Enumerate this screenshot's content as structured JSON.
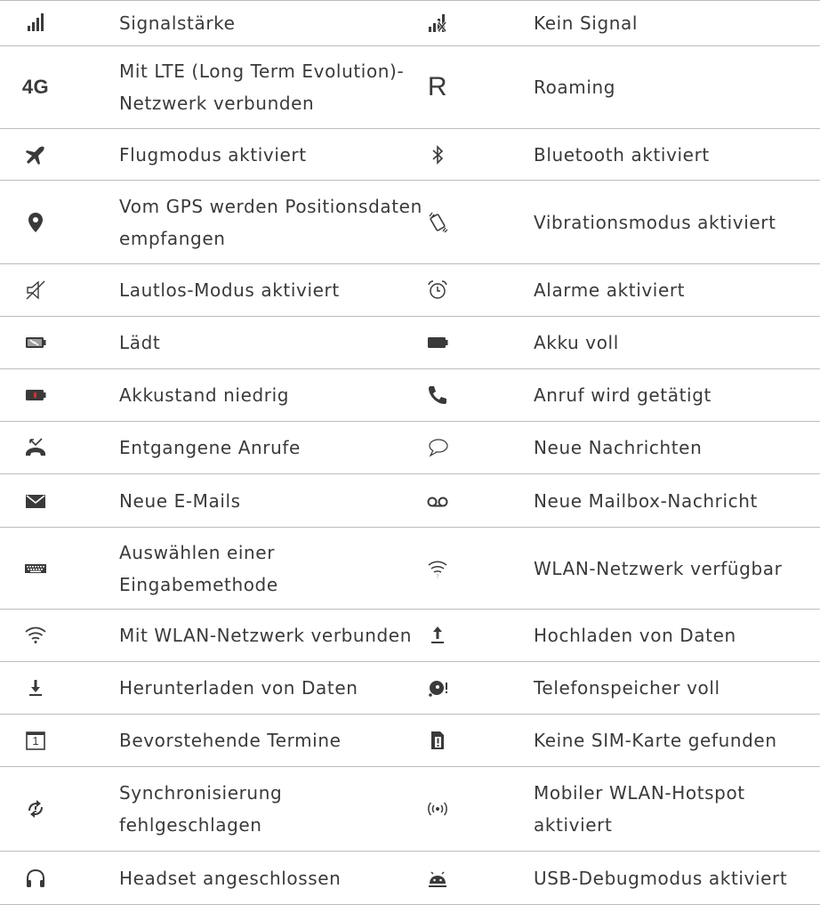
{
  "colors": {
    "icon": "#3a3a3a",
    "divider": "#bdbdbd",
    "battery_low": "#d32f2f"
  },
  "rows": [
    {
      "left": {
        "icon": "signal-strength-icon",
        "label": "Signalstärke"
      },
      "right": {
        "icon": "no-signal-icon",
        "label": "Kein Signal"
      }
    },
    {
      "left": {
        "icon": "lte-4g-icon",
        "icon_text": "4G",
        "label": "Mit LTE (Long Term Evolution)-Netzwerk verbunden"
      },
      "right": {
        "icon": "roaming-icon",
        "icon_text": "R",
        "label": "Roaming"
      }
    },
    {
      "left": {
        "icon": "airplane-icon",
        "label": "Flugmodus aktiviert"
      },
      "right": {
        "icon": "bluetooth-icon",
        "label": "Bluetooth aktiviert"
      }
    },
    {
      "left": {
        "icon": "gps-pin-icon",
        "label": "Vom GPS werden Positionsdaten empfangen"
      },
      "right": {
        "icon": "vibrate-icon",
        "label": "Vibrationsmodus aktiviert"
      }
    },
    {
      "left": {
        "icon": "silent-mode-icon",
        "label": "Lautlos-Modus aktiviert"
      },
      "right": {
        "icon": "alarm-icon",
        "label": "Alarme aktiviert"
      }
    },
    {
      "left": {
        "icon": "battery-charging-icon",
        "label": "Lädt"
      },
      "right": {
        "icon": "battery-full-icon",
        "label": "Akku voll"
      }
    },
    {
      "left": {
        "icon": "battery-low-icon",
        "label": "Akkustand niedrig"
      },
      "right": {
        "icon": "phone-call-icon",
        "label": "Anruf wird getätigt"
      }
    },
    {
      "left": {
        "icon": "missed-call-icon",
        "label": "Entgangene Anrufe"
      },
      "right": {
        "icon": "message-bubble-icon",
        "label": "Neue Nachrichten"
      }
    },
    {
      "left": {
        "icon": "email-icon",
        "label": "Neue E-Mails"
      },
      "right": {
        "icon": "voicemail-icon",
        "label": "Neue Mailbox-Nachricht"
      }
    },
    {
      "left": {
        "icon": "keyboard-icon",
        "label": "Auswählen einer Eingabemethode"
      },
      "right": {
        "icon": "wifi-available-icon",
        "label": "WLAN-Netzwerk verfügbar"
      }
    },
    {
      "left": {
        "icon": "wifi-connected-icon",
        "label": "Mit WLAN-Netzwerk verbunden"
      },
      "right": {
        "icon": "upload-icon",
        "label": "Hochladen von Daten"
      }
    },
    {
      "left": {
        "icon": "download-icon",
        "label": "Herunterladen von Daten"
      },
      "right": {
        "icon": "storage-full-icon",
        "label": "Telefonspeicher voll"
      }
    },
    {
      "left": {
        "icon": "calendar-icon",
        "icon_text": "1",
        "label": "Bevorstehende Termine"
      },
      "right": {
        "icon": "no-sim-icon",
        "label": "Keine SIM-Karte gefunden"
      }
    },
    {
      "left": {
        "icon": "sync-failed-icon",
        "label": "Synchronisierung fehlgeschlagen"
      },
      "right": {
        "icon": "hotspot-icon",
        "label": "Mobiler WLAN-Hotspot aktiviert"
      }
    },
    {
      "left": {
        "icon": "headset-icon",
        "label": "Headset angeschlossen"
      },
      "right": {
        "icon": "usb-debug-android-icon",
        "label": "USB-Debugmodus aktiviert"
      }
    }
  ]
}
